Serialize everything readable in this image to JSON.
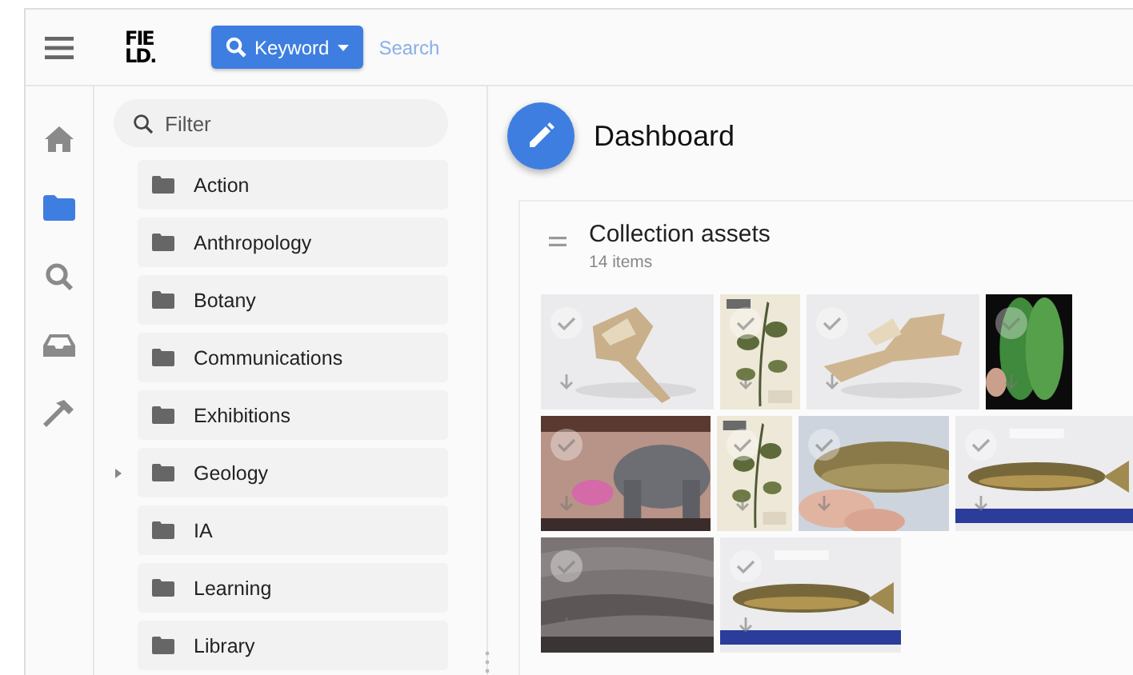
{
  "top_bar": {
    "logo": {
      "line_1": "FIE",
      "line_2": "LD."
    },
    "search_mode": {
      "label": "Keyword"
    },
    "search": {
      "placeholder": "Search"
    }
  },
  "rail": [
    {
      "kind": "home",
      "selected": false
    },
    {
      "kind": "folder",
      "selected": true
    },
    {
      "kind": "search",
      "selected": false
    },
    {
      "kind": "inbox",
      "selected": false
    },
    {
      "kind": "hammer",
      "selected": false
    }
  ],
  "sidebar": {
    "filter": {
      "placeholder": "Filter"
    },
    "folders": [
      {
        "label": "Action",
        "has_children": false
      },
      {
        "label": "Anthropology",
        "has_children": false
      },
      {
        "label": "Botany",
        "has_children": false
      },
      {
        "label": "Communications",
        "has_children": false
      },
      {
        "label": "Exhibitions",
        "has_children": false
      },
      {
        "label": "Geology",
        "has_children": true
      },
      {
        "label": "IA",
        "has_children": false
      },
      {
        "label": "Learning",
        "has_children": false
      },
      {
        "label": "Library",
        "has_children": false
      }
    ]
  },
  "page": {
    "title": "Dashboard"
  },
  "card": {
    "title": "Collection assets",
    "count": "14 items"
  }
}
